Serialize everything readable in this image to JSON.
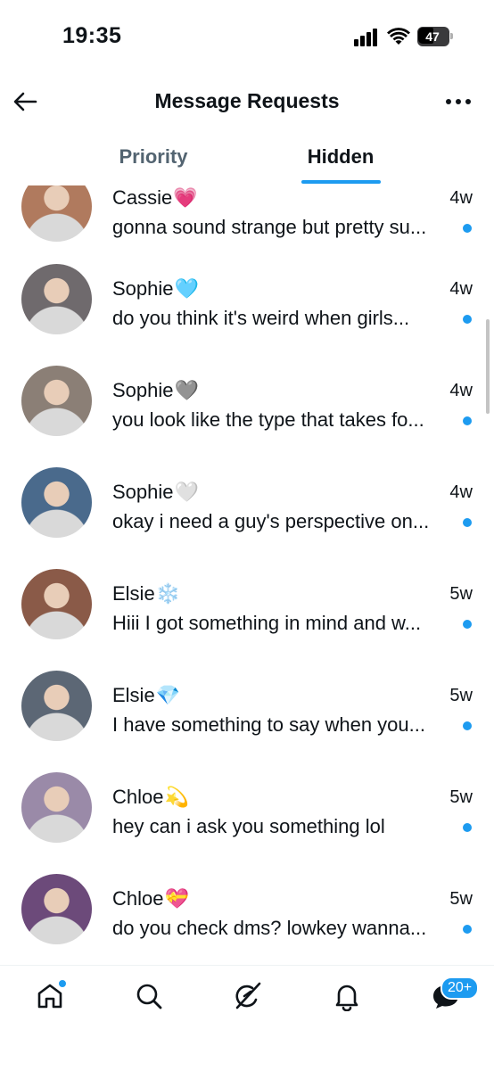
{
  "status": {
    "time": "19:35",
    "battery": "47"
  },
  "header": {
    "title": "Message Requests"
  },
  "tabs": [
    {
      "label": "Priority"
    },
    {
      "label": "Hidden"
    }
  ],
  "rows": [
    {
      "name": "Cassie",
      "emoji": "💗",
      "time": "4w",
      "preview": "gonna sound strange but pretty su...",
      "avatar_color": "#b07a5e"
    },
    {
      "name": "Sophie",
      "emoji": "🩵",
      "time": "4w",
      "preview": "do you think it's weird when girls...",
      "avatar_color": "#6f6a6d"
    },
    {
      "name": "Sophie",
      "emoji": "🩶",
      "time": "4w",
      "preview": "you look like the type that takes fo...",
      "avatar_color": "#8b7f76"
    },
    {
      "name": "Sophie",
      "emoji": "🤍",
      "time": "4w",
      "preview": "okay i need a guy's perspective on...",
      "avatar_color": "#4a6a8c"
    },
    {
      "name": "Elsie",
      "emoji": "❄️",
      "time": "5w",
      "preview": "Hiii I got something in mind and w...",
      "avatar_color": "#8a5a48"
    },
    {
      "name": "Elsie",
      "emoji": "💎",
      "time": "5w",
      "preview": "I have something to say when you...",
      "avatar_color": "#5c6775"
    },
    {
      "name": "Chloe",
      "emoji": "💫",
      "time": "5w",
      "preview": "hey can i ask you something lol",
      "avatar_color": "#9a8aa8"
    },
    {
      "name": "Chloe",
      "emoji": "💝",
      "time": "5w",
      "preview": "do you check dms? lowkey wanna...",
      "avatar_color": "#6c4a7a"
    }
  ],
  "nav": {
    "dm_badge": "20+"
  },
  "colors": {
    "accent": "#1d9bf0",
    "text": "#0f1419",
    "muted": "#536471"
  }
}
